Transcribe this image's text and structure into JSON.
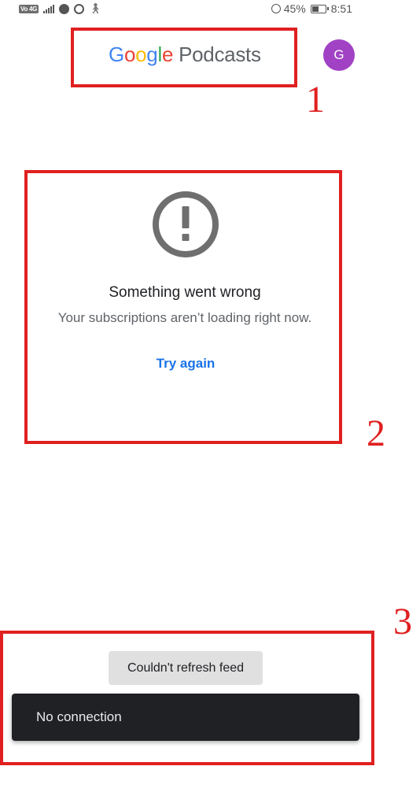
{
  "status_bar": {
    "carrier": "Vo 4G",
    "battery": "45%",
    "time": "8:51",
    "icons": [
      "signal-icon",
      "spotify-icon",
      "whatsapp-icon",
      "walk-icon",
      "alarm-icon",
      "battery-icon"
    ]
  },
  "header": {
    "logo_google": [
      "G",
      "o",
      "o",
      "g",
      "l",
      "e"
    ],
    "logo_product": "Podcasts",
    "avatar_letter": "G",
    "avatar_color": "#a142c4"
  },
  "error": {
    "icon": "error-alert-icon",
    "title": "Something went wrong",
    "message": "Your subscriptions aren’t loading right now.",
    "retry_label": "Try again"
  },
  "feed": {
    "refresh_status": "Couldn't refresh feed"
  },
  "snackbar": {
    "message": "No connection"
  },
  "annotations": [
    "1",
    "2",
    "3"
  ],
  "colors": {
    "accent": "#1a73e8",
    "annotation": "#e02020",
    "snackbar_bg": "#202124"
  }
}
